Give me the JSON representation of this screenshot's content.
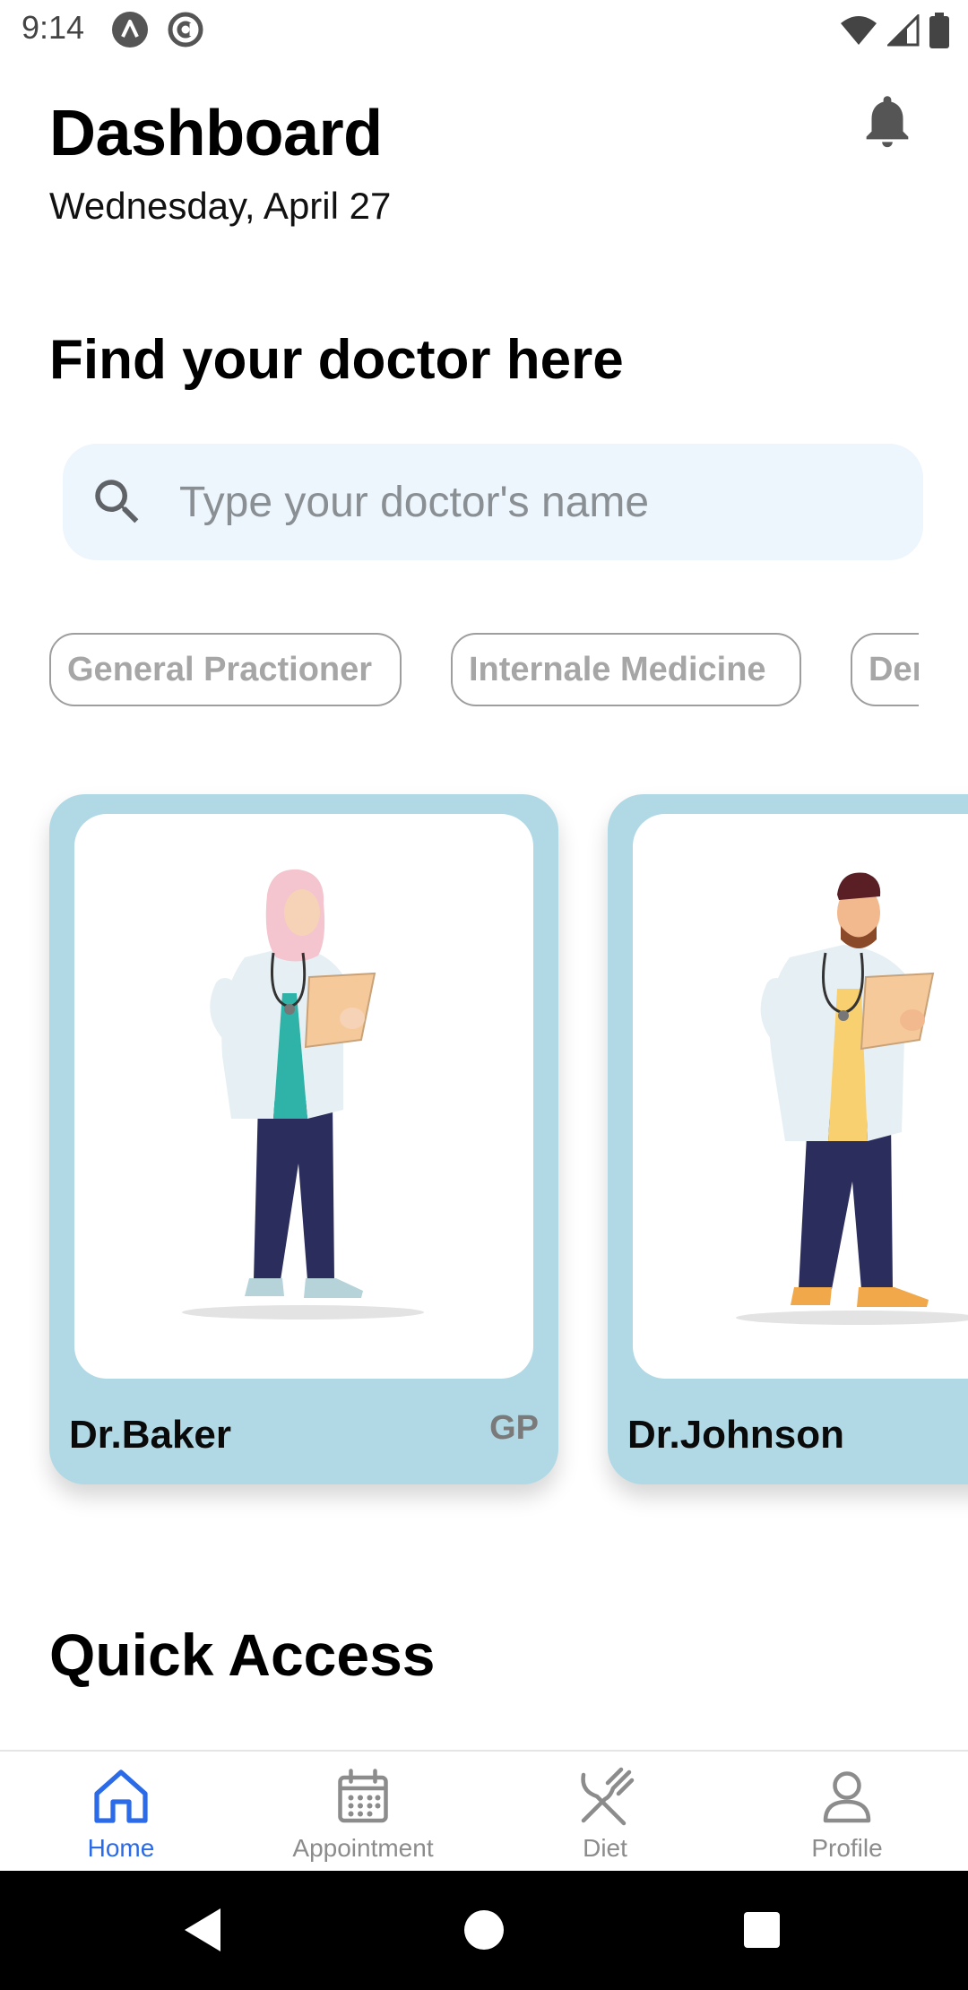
{
  "status_bar": {
    "time": "9:14"
  },
  "header": {
    "title": "Dashboard",
    "date": "Wednesday, April 27"
  },
  "find_section": {
    "title": "Find your doctor here"
  },
  "search": {
    "placeholder": "Type your doctor's name",
    "value": ""
  },
  "categories": [
    {
      "label": "General Practioner"
    },
    {
      "label": "Internale Medicine"
    },
    {
      "label": "Der"
    }
  ],
  "doctors": [
    {
      "name": "Dr.Baker",
      "specialty": "GP"
    },
    {
      "name": "Dr.Johnson",
      "specialty": ""
    }
  ],
  "quick_access": {
    "title": "Quick Access"
  },
  "bottom_nav": {
    "items": [
      {
        "label": "Home",
        "icon": "home-icon",
        "active": true
      },
      {
        "label": "Appointment",
        "icon": "calendar-icon",
        "active": false
      },
      {
        "label": "Diet",
        "icon": "fork-knife-icon",
        "active": false
      },
      {
        "label": "Profile",
        "icon": "user-icon",
        "active": false
      }
    ]
  },
  "colors": {
    "accent": "#2b6be8",
    "card_bg": "#b0d9e5",
    "search_bg": "#edf5fd",
    "chip_border": "#9e9e9e",
    "chip_text": "#a6a6a6",
    "nav_inactive": "#8c8c8c"
  }
}
